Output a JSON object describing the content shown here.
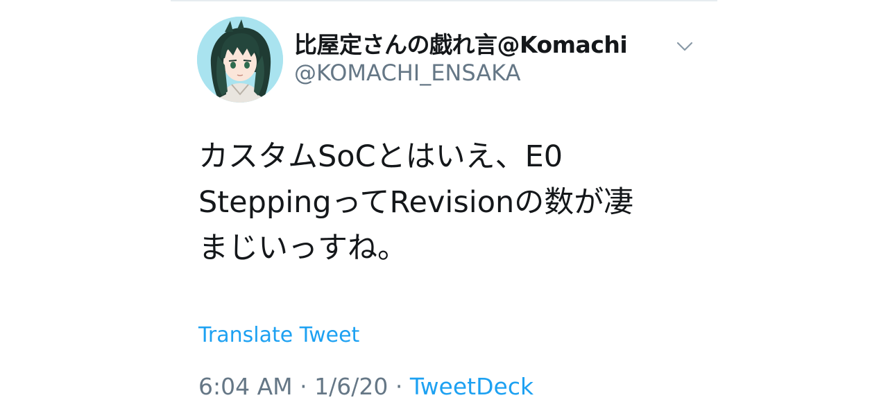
{
  "tweet": {
    "display_name": "比屋定さんの戯れ言@Komachi",
    "handle": "@KOMACHI_ENSAKA",
    "text_lines": [
      "カスタムSoCとはいえ、E0",
      "SteppingってRevisionの数が凄",
      "まじいっすね。"
    ],
    "translate_label": "Translate Tweet",
    "time": "6:04 AM",
    "separator": "·",
    "date": "1/6/20",
    "source": "TweetDeck"
  },
  "icons": {
    "menu": "chevron-down-icon",
    "avatar": "avatar"
  },
  "colors": {
    "link": "#1da1f2",
    "text": "#14171a",
    "muted": "#657786",
    "avatar_bg": "#a9e3ef"
  }
}
